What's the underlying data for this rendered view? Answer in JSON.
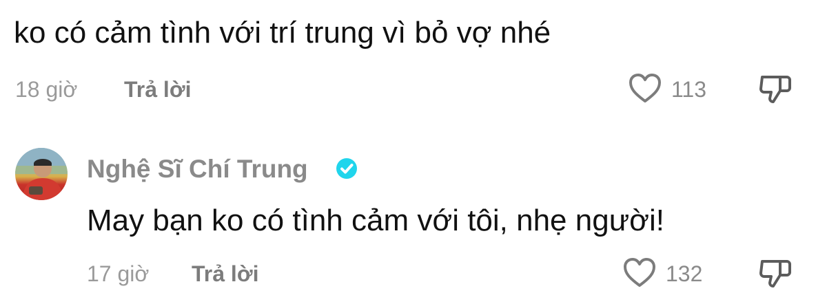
{
  "comment": {
    "text": "ko có cảm tình với trí trung vì bỏ vợ nhé",
    "time": "18 giờ",
    "reply_label": "Trả lời",
    "like_count": "113"
  },
  "reply": {
    "author": "Nghệ Sĩ Chí Trung",
    "verified": true,
    "text": "May bạn ko có tình cảm với tôi, nhẹ người!",
    "time": "17 giờ",
    "reply_label": "Trả lời",
    "like_count": "132"
  },
  "colors": {
    "verified_badge": "#20d5ec",
    "muted_text": "#8a8a8a"
  },
  "icons": {
    "like": "heart-outline-icon",
    "dislike": "thumbs-down-icon",
    "verified": "verified-badge-icon"
  }
}
